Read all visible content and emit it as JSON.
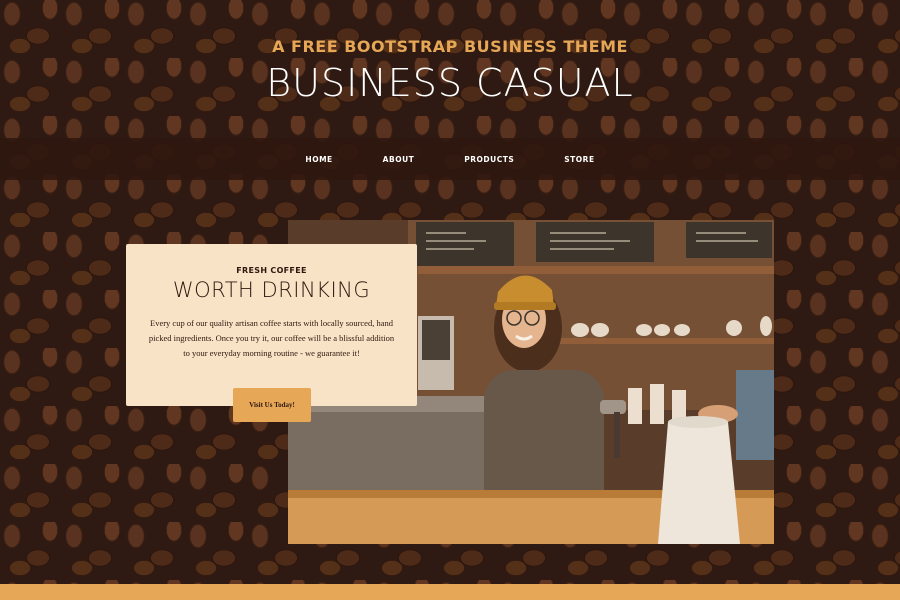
{
  "header": {
    "upper": "A FREE BOOTSTRAP BUSINESS THEME",
    "lower": "BUSINESS CASUAL"
  },
  "nav": {
    "items": [
      "HOME",
      "ABOUT",
      "PRODUCTS",
      "STORE"
    ]
  },
  "product": {
    "title_upper": "FRESH COFFEE",
    "title_lower": "WORTH DRINKING",
    "description": "Every cup of our quality artisan coffee starts with locally sourced, hand picked ingredients. Once you try it, our coffee will be a blissful addition to your everyday morning routine - we guarantee it!",
    "button_label": "Visit Us Today!",
    "image_icon": "barista-photo"
  },
  "colors": {
    "accent": "#e6a756",
    "dark": "#2f170f",
    "card": "#f8e3c6"
  }
}
